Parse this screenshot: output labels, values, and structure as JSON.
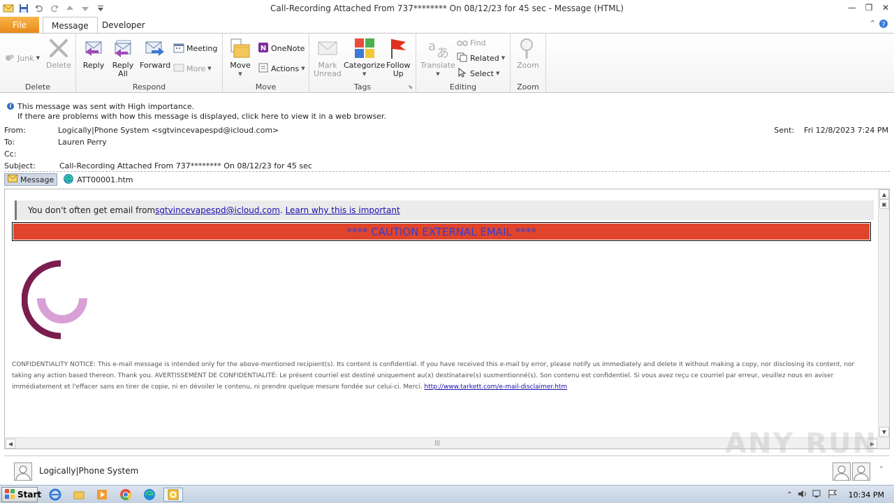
{
  "window": {
    "title": "Call-Recording Attached From 737******** On 08/12/23 for 45 sec  -  Message (HTML)",
    "controls": {
      "minimize": "—",
      "maximize": "❐",
      "close": "✕"
    }
  },
  "tabs": {
    "file": "File",
    "items": [
      {
        "label": "Message",
        "active": true
      },
      {
        "label": "Developer",
        "active": false
      }
    ]
  },
  "ribbon": {
    "groups": {
      "delete": "Delete",
      "respond": "Respond",
      "move": "Move",
      "tags": "Tags",
      "editing": "Editing",
      "zoom": "Zoom"
    },
    "buttons": {
      "junk": "Junk",
      "delete": "Delete",
      "reply": "Reply",
      "reply_all_1": "Reply",
      "reply_all_2": "All",
      "forward": "Forward",
      "meeting": "Meeting",
      "more": "More",
      "move": "Move",
      "onenote": "OneNote",
      "actions": "Actions",
      "mark_unread_1": "Mark",
      "mark_unread_2": "Unread",
      "categorize": "Categorize",
      "follow_up_1": "Follow",
      "follow_up_2": "Up",
      "translate": "Translate",
      "find": "Find",
      "related": "Related",
      "select": "Select",
      "zoom": "Zoom"
    }
  },
  "info": {
    "importance": "This message was sent with High importance.",
    "display_problem": "If there are problems with how this message is displayed, click here to view it in a web browser."
  },
  "header": {
    "from_label": "From:",
    "from_value": "Logically|Phone System <sgtvincevapespd@icloud.com>",
    "to_label": "To:",
    "to_value": "Lauren Perry",
    "cc_label": "Cc:",
    "subject_label": "Subject:",
    "subject_value": "Call-Recording Attached From 737******** On 08/12/23 for 45 sec",
    "sent_label": "Sent:",
    "sent_value": "Fri 12/8/2023 7:24 PM"
  },
  "attachments": [
    {
      "label": "Message",
      "selected": true
    },
    {
      "label": "ATT00001.htm",
      "selected": false
    }
  ],
  "body": {
    "notice_prefix": "You don't often get email from ",
    "notice_email": "sgtvincevapespd@icloud.com",
    "notice_sep": ". ",
    "notice_link": "Learn why this is important",
    "caution": "**** CAUTION EXTERNAL EMAIL ****",
    "confidential_text": "CONFIDENTIALITY NOTICE: This e-mail message is intended only for the above-mentioned recipient(s). Its content is confidential. If you have received this e-mail by error, please notify us immediately and delete it without making a copy, nor disclosing its content, nor taking any action based thereon. Thank you. AVERTISSEMENT DE CONFIDENTIALITÉ: Le présent courriel est destiné uniquement au(x) destinataire(s) susmentionné(s). Son contenu est confidentiel. Si vous avez reçu ce courriel par erreur, veuillez nous en aviser immédiatement et l'effacer sans en tirer de copie, ni en dévoiler le contenu, ni prendre quelque mesure fondée sur celui-ci. Merci. ",
    "disclaimer_link": "http://www.tarkett.com/e-mail-disclaimer.htm"
  },
  "people_pane": {
    "name": "Logically|Phone System"
  },
  "taskbar": {
    "start": "Start",
    "clock": "10:34 PM"
  },
  "watermark": "ANY RUN",
  "colors": {
    "caution_bg": "#e0452c",
    "caution_text": "#2f3fd6",
    "file_tab": "#e8891b",
    "logo_dark": "#7a1d4f",
    "logo_light": "#d9a0d6"
  }
}
